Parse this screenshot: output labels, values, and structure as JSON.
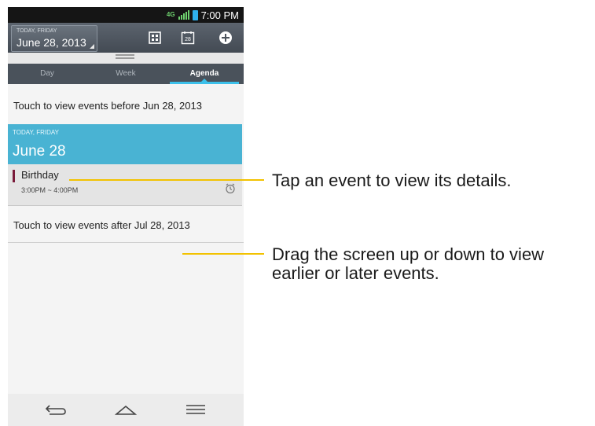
{
  "status_bar": {
    "network": "4G",
    "time": "7:00 PM"
  },
  "toolbar": {
    "date_sub": "TODAY, FRIDAY",
    "date_main": "June 28, 2013",
    "icons": [
      "month-view-icon",
      "day-calendar-icon",
      "add-event-icon"
    ]
  },
  "tabs": [
    {
      "label": "Day"
    },
    {
      "label": "Week"
    },
    {
      "label": "Agenda",
      "active": true
    }
  ],
  "agenda": {
    "before_text": "Touch to view events before Jun 28, 2013",
    "today_sub": "TODAY, FRIDAY",
    "today_main": "June 28",
    "event": {
      "title": "Birthday",
      "time": "3:00PM ~ 4:00PM",
      "color": "#7a1a3a"
    },
    "after_text": "Touch to view events after Jul 28, 2013"
  },
  "navigation": [
    "back-icon",
    "home-icon",
    "menu-icon"
  ],
  "callouts": {
    "event_tip": "Tap an event to view its details.",
    "drag_tip_line1": "Drag the screen up or down to view",
    "drag_tip_line2": "earlier or later events."
  },
  "colors": {
    "accent": "#49b3d3",
    "callout_line": "#f2c200",
    "toolbar": "#4a525b"
  }
}
